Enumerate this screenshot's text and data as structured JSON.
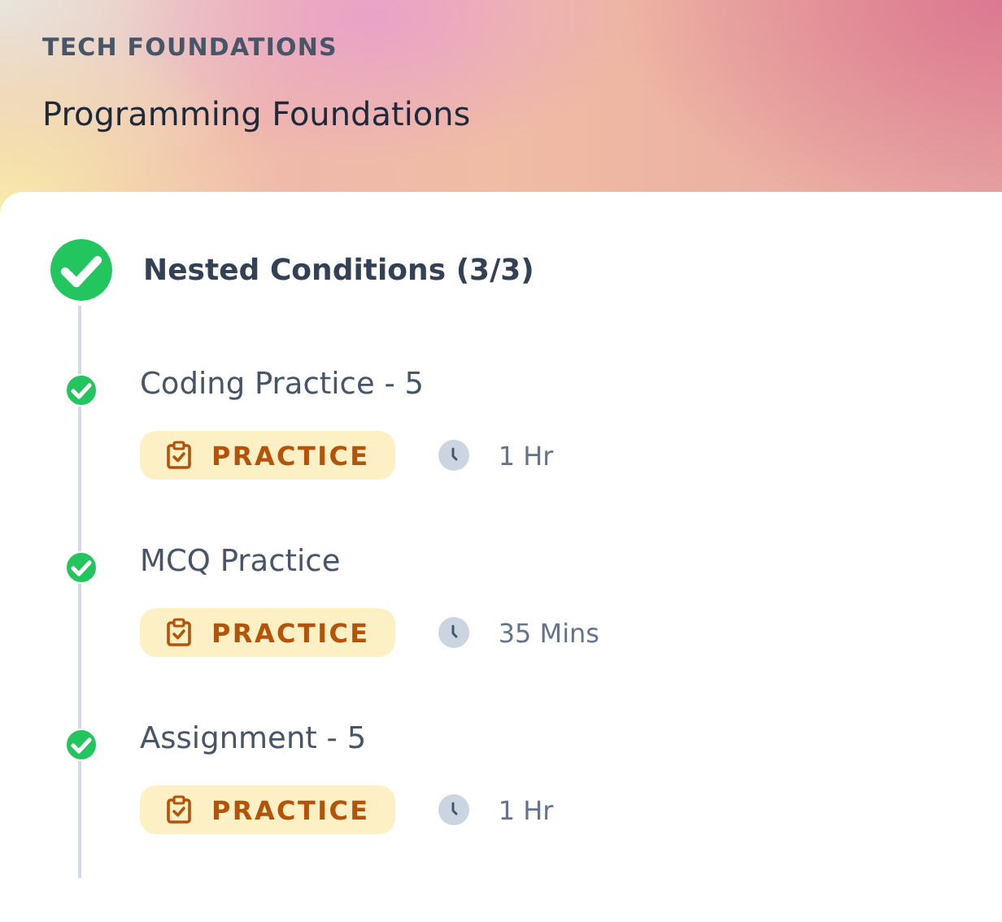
{
  "header": {
    "category": "TECH FOUNDATIONS",
    "title": "Programming Foundations"
  },
  "section": {
    "title": "Nested Conditions (3/3)",
    "completed": true,
    "items": [
      {
        "title": "Coding Practice - 5",
        "completed": true,
        "badge": "PRACTICE",
        "duration": "1 Hr"
      },
      {
        "title": "MCQ Practice",
        "completed": true,
        "badge": "PRACTICE",
        "duration": "35 Mins"
      },
      {
        "title": "Assignment - 5",
        "completed": true,
        "badge": "PRACTICE",
        "duration": "1 Hr"
      }
    ]
  }
}
